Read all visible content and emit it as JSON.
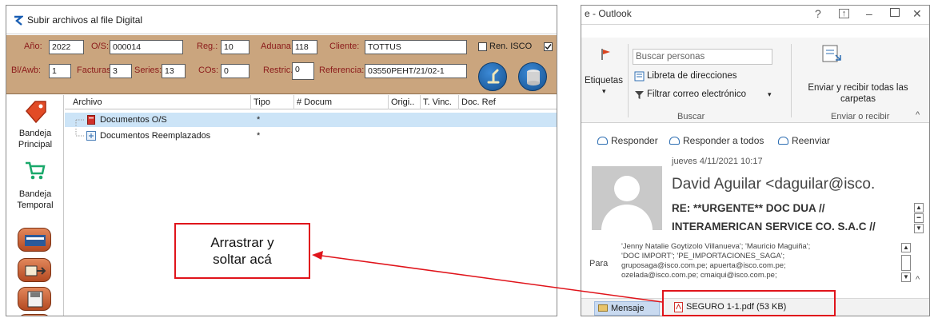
{
  "left_window": {
    "title": "Subir archivos al file Digital",
    "form": {
      "anio_label": "Año:",
      "anio_value": "2022",
      "os_label": "O/S:",
      "os_value": "000014",
      "reg_label": "Reg.:",
      "reg_value": "10",
      "aduana_label": "Aduana",
      "aduana_value": "118",
      "cliente_label": "Cliente:",
      "cliente_value": "TOTTUS",
      "ren_isco_label": "Ren. ISCO",
      "bl_label": "Bl/Awb:",
      "bl_value": "1",
      "facturas_label": "Facturas:",
      "facturas_value": "3",
      "series_label": "Series:",
      "series_value": "13",
      "cos_label": "COs:",
      "cos_value": "0",
      "restric_label": "Restric.:",
      "restric_value": "0",
      "referencia_label": "Referencia:",
      "referencia_value": "03550PEHT/21/02-1"
    },
    "sidebar": {
      "bandeja_principal": "Bandeja Principal",
      "bandeja_temporal": "Bandeja Temporal"
    },
    "grid": {
      "columns": [
        "Archivo",
        "Tipo",
        "# Docum",
        "Origi..",
        "T. Vinc.",
        "Doc. Ref"
      ],
      "rows": [
        {
          "name": "Documentos O/S",
          "tipo": "*"
        },
        {
          "name": "Documentos Reemplazados",
          "tipo": "*"
        }
      ]
    }
  },
  "right_window": {
    "title": "e - Outlook",
    "ribbon": {
      "etiquetas": "Etiquetas",
      "buscar_personas_placeholder": "Buscar personas",
      "libreta": "Libreta de direcciones",
      "filtrar": "Filtrar correo electrónico",
      "group_buscar": "Buscar",
      "enviar_recibir": "Enviar y recibir todas las carpetas",
      "group_enviar": "Enviar o recibir"
    },
    "actions": {
      "responder": "Responder",
      "responder_todos": "Responder a todos",
      "reenviar": "Reenviar"
    },
    "email": {
      "date": "jueves 4/11/2021 10:17",
      "sender": "David Aguilar <daguilar@isco.",
      "subject_line1": "RE: **URGENTE** DOC DUA //",
      "subject_line2": "INTERAMERICAN SERVICE CO. S.A.C //",
      "para_label": "Para",
      "recipients_line1": "'Jenny Natalie Goytizolo Villanueva'; 'Mauricio Maguiña';",
      "recipients_line2": "'DOC IMPORT'; 'PE_IMPORTACIONES_SAGA';",
      "recipients_line3": "gruposaga@isco.com.pe; apuerta@isco.com.pe;",
      "recipients_line4": "ozelada@isco.com.pe; cmaiqui@isco.com.pe;"
    },
    "attachment_bar": {
      "mensaje": "Mensaje",
      "file": "SEGURO 1-1.pdf (53 KB)"
    }
  },
  "annotation": {
    "text": "Arrastrar y soltar acá"
  },
  "colors": {
    "form_bg": "#caa57e",
    "label_red": "#8b1a1a",
    "selection": "#cce4f7",
    "callout_red": "#e0141b",
    "outlook_blue": "#2f6fb3"
  }
}
